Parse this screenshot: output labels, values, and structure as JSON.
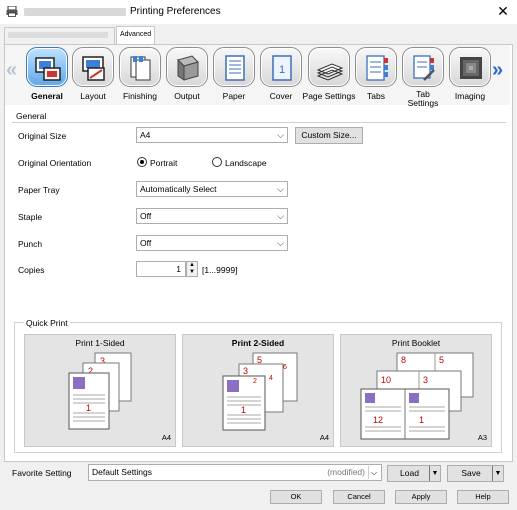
{
  "window": {
    "title": "Printing Preferences",
    "close_glyph": "✕",
    "app_icon": "printer-icon"
  },
  "tabs": [
    {
      "label": "",
      "blurred": true
    },
    {
      "label": "Advanced"
    }
  ],
  "categories": [
    {
      "label": "General",
      "icon": "general-icon",
      "active": true
    },
    {
      "label": "Layout",
      "icon": "layout-icon"
    },
    {
      "label": "Finishing",
      "icon": "finishing-icon"
    },
    {
      "label": "Output",
      "icon": "output-icon"
    },
    {
      "label": "Paper",
      "icon": "paper-icon"
    },
    {
      "label": "Cover",
      "icon": "cover-icon"
    },
    {
      "label": "Page Settings",
      "icon": "page-settings-icon"
    },
    {
      "label": "Tabs",
      "icon": "tabs-icon"
    },
    {
      "label": "Tab Settings",
      "icon": "tab-settings-icon"
    },
    {
      "label": "Imaging",
      "icon": "imaging-icon"
    }
  ],
  "nav": {
    "left": "«",
    "right": "»"
  },
  "general": {
    "group_title": "General",
    "original_size": {
      "label": "Original Size",
      "value": "A4",
      "custom_button": "Custom Size..."
    },
    "orientation": {
      "label": "Original Orientation",
      "portrait": "Portrait",
      "landscape": "Landscape",
      "selected": "Portrait"
    },
    "paper_tray": {
      "label": "Paper Tray",
      "value": "Automatically Select"
    },
    "staple": {
      "label": "Staple",
      "value": "Off"
    },
    "punch": {
      "label": "Punch",
      "value": "Off"
    },
    "copies": {
      "label": "Copies",
      "value": "1",
      "range": "[1...9999]"
    }
  },
  "quick_print": {
    "title": "Quick Print",
    "cards": [
      {
        "label": "Print 1-Sided",
        "paper": "A4",
        "pages": [
          "3",
          "2",
          "1"
        ]
      },
      {
        "label": "Print 2-Sided",
        "paper": "A4",
        "pages": [
          "5",
          "6",
          "3",
          "4",
          "1",
          "2"
        ],
        "selected": true
      },
      {
        "label": "Print Booklet",
        "paper": "A3",
        "pages": [
          "8",
          "5",
          "10",
          "3",
          "12",
          "1"
        ]
      }
    ]
  },
  "favorite": {
    "label": "Favorite Setting",
    "value": "Default Settings",
    "modified": "(modified)",
    "load": "Load",
    "save": "Save"
  },
  "buttons": {
    "ok": "OK",
    "cancel": "Cancel",
    "apply": "Apply",
    "help": "Help"
  },
  "colors": {
    "accent": "#2f68c8",
    "page_number": "#c00000",
    "active_tile": "#5fa8e8"
  }
}
